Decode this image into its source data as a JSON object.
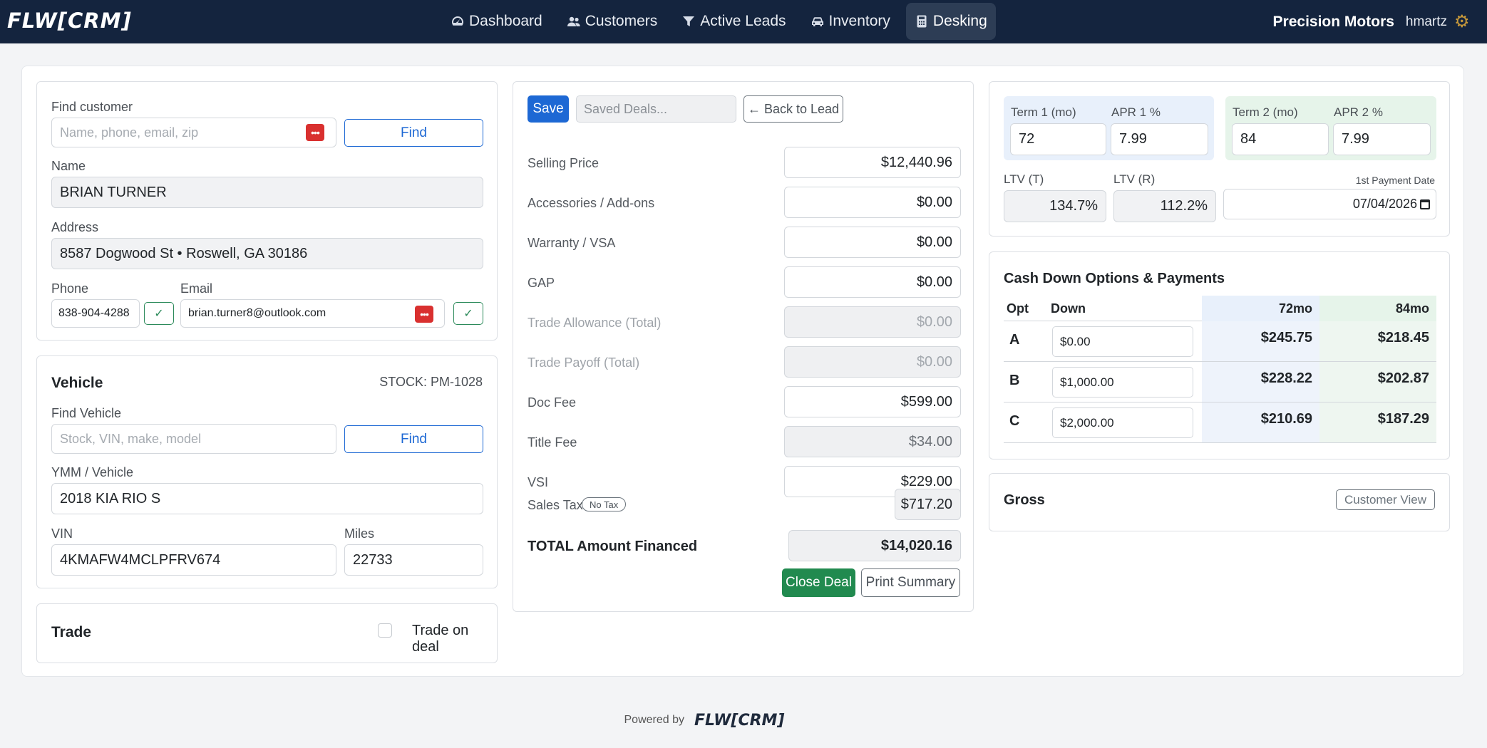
{
  "nav": {
    "logo": "FLW[CRM]",
    "links": [
      {
        "label": "Dashboard",
        "icon": "gauge-icon"
      },
      {
        "label": "Customers",
        "icon": "users-icon"
      },
      {
        "label": "Active Leads",
        "icon": "filter-icon"
      },
      {
        "label": "Inventory",
        "icon": "car-icon"
      },
      {
        "label": "Desking",
        "icon": "calculator-icon"
      }
    ],
    "active": "Desking",
    "dealer": "Precision Motors",
    "user": "hmartz"
  },
  "customer": {
    "find_label": "Find customer",
    "find_placeholder": "Name, phone, email, zip",
    "find_button": "Find",
    "name_label": "Name",
    "name": "BRIAN TURNER",
    "address_label": "Address",
    "address": "8587 Dogwood St • Roswell, GA 30186",
    "phone_label": "Phone",
    "phone": "838-904-4288",
    "email_label": "Email",
    "email": "brian.turner8@outlook.com",
    "check": "✓"
  },
  "vehicle": {
    "title": "Vehicle",
    "stock": "STOCK: PM-1028",
    "find_label": "Find Vehicle",
    "find_placeholder": "Stock, VIN, make, model",
    "find_button": "Find",
    "ymm_label": "YMM / Vehicle",
    "ymm": "2018 KIA RIO S",
    "vin_label": "VIN",
    "vin": "4KMAFW4MCLPFRV674",
    "miles_label": "Miles",
    "miles": "22733"
  },
  "trade": {
    "title": "Trade",
    "checkbox_label": "Trade on deal"
  },
  "deal": {
    "save": "Save",
    "saved_deals": "Saved Deals...",
    "back": "← Back to Lead",
    "rows": [
      {
        "label": "Selling Price",
        "value": "$12,440.96"
      },
      {
        "label": "Accessories / Add-ons",
        "value": "$0.00"
      },
      {
        "label": "Warranty / VSA",
        "value": "$0.00"
      },
      {
        "label": "GAP",
        "value": "$0.00"
      },
      {
        "label": "Trade Allowance (Total)",
        "value": "$0.00"
      },
      {
        "label": "Trade Payoff (Total)",
        "value": "$0.00"
      },
      {
        "label": "Doc Fee",
        "value": "$599.00"
      },
      {
        "label": "Title Fee",
        "value": "$34.00"
      },
      {
        "label": "VSI",
        "value": "$229.00"
      }
    ],
    "sales_tax_label": "Sales Tax",
    "no_tax_badge": "No Tax",
    "sales_tax": "$717.20",
    "total_label": "TOTAL Amount Financed",
    "total": "$14,020.16",
    "close_deal": "Close Deal",
    "print_summary": "Print Summary"
  },
  "terms": {
    "term1_label": "Term 1 (mo)",
    "term1": "72",
    "apr1_label": "APR 1 %",
    "apr1": "7.99",
    "term2_label": "Term 2 (mo)",
    "term2": "84",
    "apr2_label": "APR 2 %",
    "apr2": "7.99",
    "ltv_t_label": "LTV (T)",
    "ltv_t": "134.7%",
    "ltv_r_label": "LTV (R)",
    "ltv_r": "112.2%",
    "first_payment_label": "1st Payment Date",
    "first_payment": "07/04/2026"
  },
  "cash": {
    "title": "Cash Down Options & Payments",
    "headers": {
      "opt": "Opt",
      "down": "Down",
      "t1": "72mo",
      "t2": "84mo"
    },
    "rows": [
      {
        "opt": "A",
        "down": "$0.00",
        "p1": "$245.75",
        "p2": "$218.45"
      },
      {
        "opt": "B",
        "down": "$1,000.00",
        "p1": "$228.22",
        "p2": "$202.87"
      },
      {
        "opt": "C",
        "down": "$2,000.00",
        "p1": "$210.69",
        "p2": "$187.29"
      }
    ]
  },
  "gross": {
    "title": "Gross",
    "customer_view": "Customer View"
  },
  "footer": {
    "powered_by": "Powered by",
    "logo": "FLW[CRM]"
  },
  "colors": {
    "navbar": "#14243e",
    "primary": "#1d68d4",
    "success": "#218a4f",
    "danger": "#d9302f",
    "term1_bg": "#e8f0fb",
    "term2_bg": "#e6f4ea"
  }
}
